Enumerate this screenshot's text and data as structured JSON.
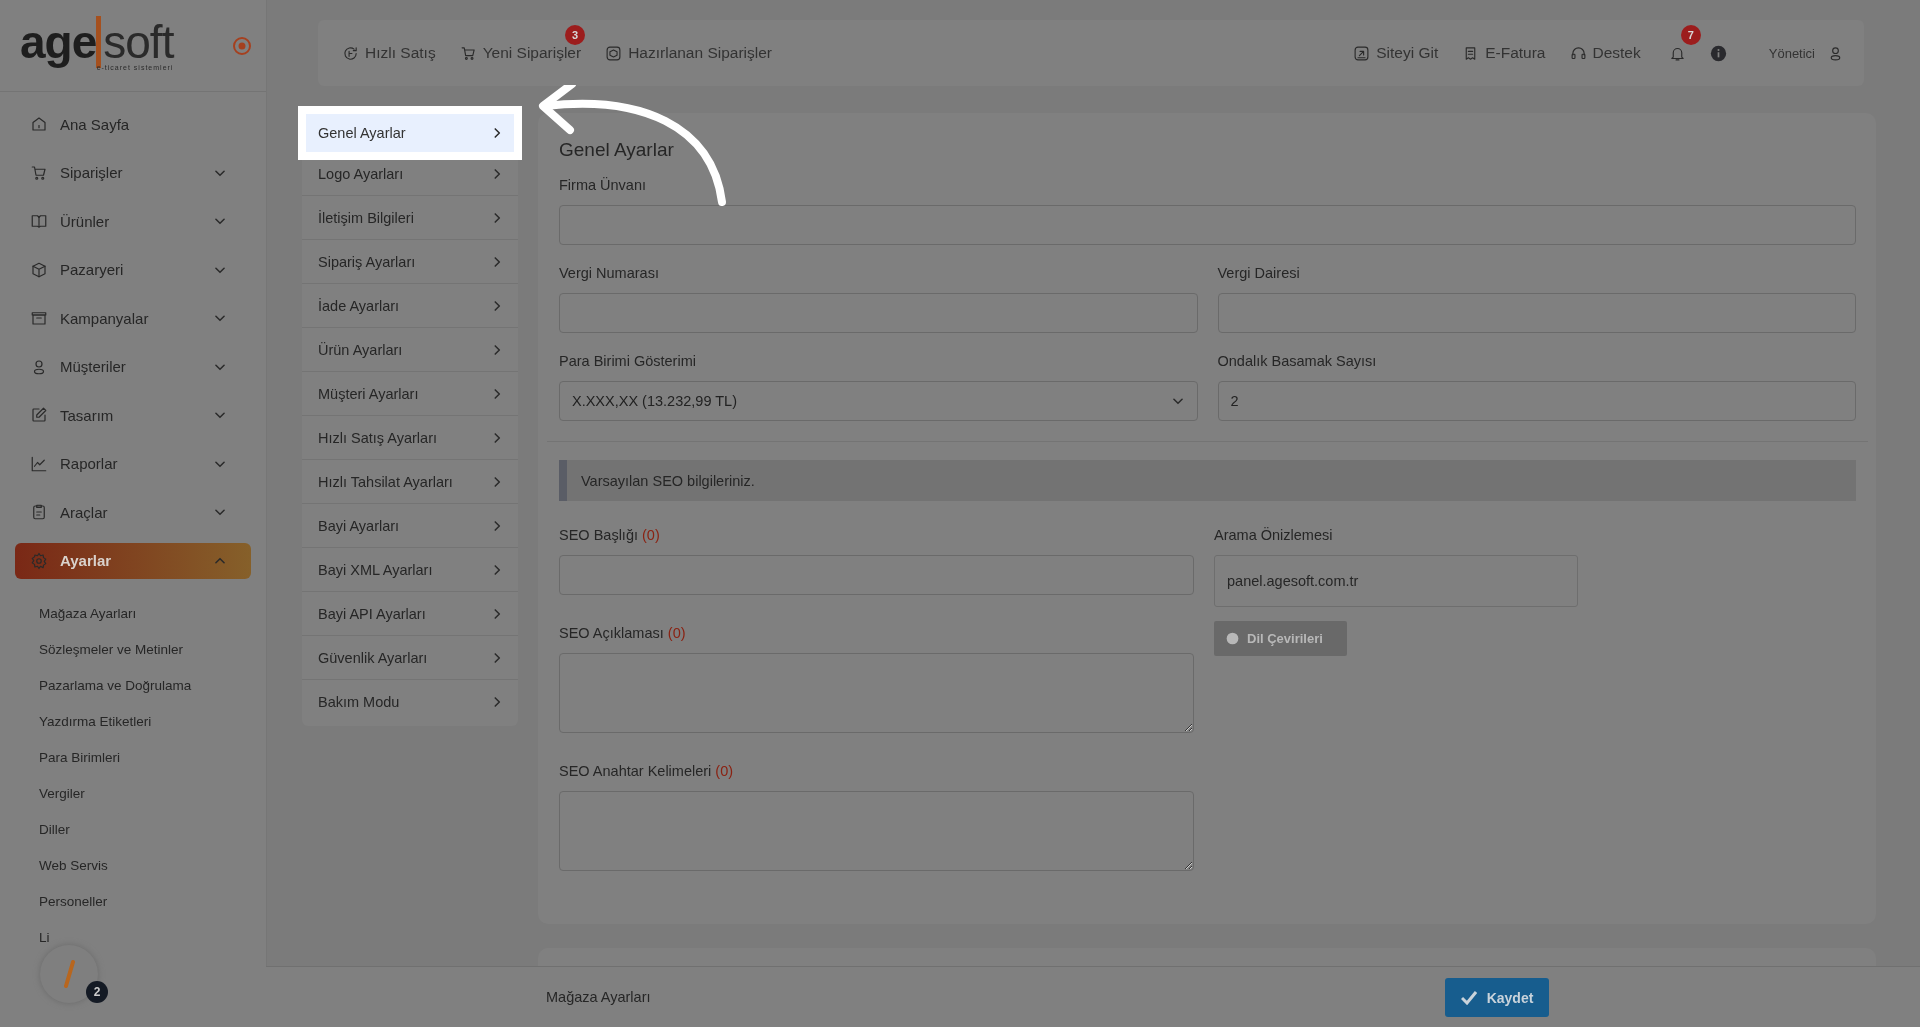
{
  "logo": {
    "word_left": "age",
    "word_right": "soft",
    "tagline": "e-ticaret sistemleri"
  },
  "sidebar": {
    "items": [
      {
        "label": "Ana Sayfa",
        "kind": "link",
        "selected": false
      },
      {
        "label": "Siparişler",
        "kind": "group",
        "expanded": false,
        "selected": false
      },
      {
        "label": "Ürünler",
        "kind": "group",
        "expanded": false,
        "selected": false
      },
      {
        "label": "Pazaryeri",
        "kind": "group",
        "expanded": false,
        "selected": false
      },
      {
        "label": "Kampanyalar",
        "kind": "group",
        "expanded": false,
        "selected": false
      },
      {
        "label": "Müşteriler",
        "kind": "group",
        "expanded": false,
        "selected": false
      },
      {
        "label": "Tasarım",
        "kind": "group",
        "expanded": false,
        "selected": false
      },
      {
        "label": "Raporlar",
        "kind": "group",
        "expanded": false,
        "selected": false
      },
      {
        "label": "Araçlar",
        "kind": "group",
        "expanded": false,
        "selected": false
      },
      {
        "label": "Ayarlar",
        "kind": "group",
        "expanded": true,
        "selected": true,
        "children": [
          "Mağaza Ayarları",
          "Sözleşmeler ve Metinler",
          "Pazarlama ve Doğrulama",
          "Yazdırma Etiketleri",
          "Para Birimleri",
          "Vergiler",
          "Diller",
          "Web Servis",
          "Personeller",
          "Li"
        ]
      }
    ]
  },
  "topbar": {
    "left": [
      {
        "label": "Hızlı Satış"
      },
      {
        "label": "Yeni Siparişler",
        "badge": "3"
      },
      {
        "label": "Hazırlanan Siparişler"
      }
    ],
    "right": [
      {
        "label": "Siteyi Git"
      },
      {
        "label": "E-Fatura"
      },
      {
        "label": "Destek"
      }
    ],
    "notification_badge": "7",
    "user": "Yönetici"
  },
  "settings_menu": {
    "items": [
      {
        "label": "Genel Ayarlar",
        "selected": true
      },
      {
        "label": "Logo Ayarları",
        "selected": false
      },
      {
        "label": "İletişim Bilgileri",
        "selected": false
      },
      {
        "label": "Sipariş Ayarları",
        "selected": false
      },
      {
        "label": "İade Ayarları",
        "selected": false
      },
      {
        "label": "Ürün Ayarları",
        "selected": false
      },
      {
        "label": "Müşteri Ayarları",
        "selected": false
      },
      {
        "label": "Hızlı Satış Ayarları",
        "selected": false
      },
      {
        "label": "Hızlı Tahsilat Ayarları",
        "selected": false
      },
      {
        "label": "Bayi Ayarları",
        "selected": false
      },
      {
        "label": "Bayi XML Ayarları",
        "selected": false
      },
      {
        "label": "Bayi API Ayarları",
        "selected": false
      },
      {
        "label": "Güvenlik Ayarları",
        "selected": false
      },
      {
        "label": "Bakım Modu",
        "selected": false
      }
    ]
  },
  "form": {
    "title": "Genel Ayarlar",
    "rows": [
      [
        {
          "label": "Firma Ünvanı",
          "kind": "text"
        }
      ],
      [
        {
          "label": "Vergi Numarası",
          "kind": "text"
        },
        {
          "label": "Vergi Dairesi",
          "kind": "text"
        }
      ],
      [
        {
          "label": "Para Birimi Gösterimi",
          "kind": "select",
          "value": "X.XXX,XX (13.232,99 TL)"
        },
        {
          "label": "Ondalık Basamak Sayısı",
          "kind": "text",
          "value": "2"
        }
      ]
    ],
    "info": "Varsayılan SEO bilgileriniz.",
    "seo_fields": [
      {
        "label": "SEO Başlığı",
        "counter": "(0)",
        "kind": "text"
      },
      {
        "label": "SEO Açıklaması",
        "counter": "(0)",
        "kind": "textarea"
      },
      {
        "label": "SEO Anahtar Kelimeleri",
        "counter": "(0)",
        "kind": "textarea"
      }
    ],
    "preview": {
      "label": "Arama Önizlemesi",
      "value": "panel.agesoft.com.tr",
      "button": "Dil Çevirileri",
      "disabled": true
    }
  },
  "footer": {
    "breadcrumb": "Mağaza Ayarları",
    "save": "Kaydet"
  },
  "floating_badge": "2"
}
